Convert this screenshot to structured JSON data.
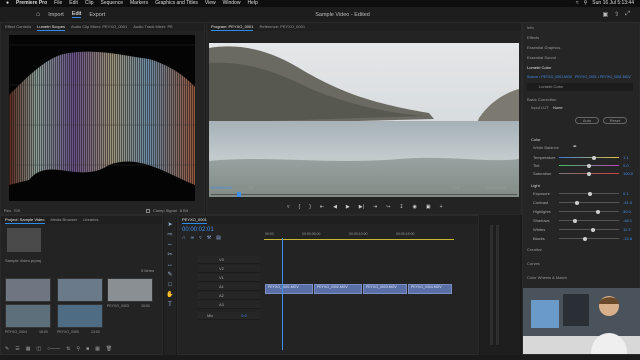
{
  "menubar": {
    "apple": "",
    "app": "Premiere Pro",
    "items": [
      "File",
      "Edit",
      "Clip",
      "Sequence",
      "Markers",
      "Graphics and Titles",
      "View",
      "Window",
      "Help"
    ],
    "clock": "Sun 16 Jul 5:13:44"
  },
  "header": {
    "home_icon": "home-icon",
    "tabs": [
      "Import",
      "Edit",
      "Export"
    ],
    "active_tab": "Edit",
    "title": "Sample Video - Edited"
  },
  "scopes_panel": {
    "tabs": [
      "Effect Controls",
      "Lumetri Scopes",
      "Audio Clip Mixer: PEYXO_0001",
      "Audio Track Mixer: PE"
    ],
    "active": "Lumetri Scopes",
    "footer_left": "Rec. 709",
    "clamp_label": "Clamp Signal",
    "bit_label": "8 Bit"
  },
  "program_panel": {
    "tabs": [
      "Program: PEYXO_0001",
      "Reference: PEYXO_0001"
    ],
    "timecode_left": "00:00:02:01",
    "fit": "Fit",
    "quality": "Full",
    "timecode_right": "00:00:20:00"
  },
  "project_panel": {
    "tabs": [
      "Project: Sample Video",
      "Media Browser",
      "Libraries"
    ],
    "file": "Sample Video.prproj",
    "count": "5 Items",
    "clips": [
      {
        "name": "PEYXO_0001",
        "dur": "19:00",
        "color": "#6f7681"
      },
      {
        "name": "PEYXO_0002",
        "dur": "11:00",
        "color": "#6a7a8a"
      },
      {
        "name": "PEYXO_0003",
        "dur": "15:00",
        "color": "#8a8f93"
      },
      {
        "name": "PEYXO_0004",
        "dur": "18:00",
        "color": "#5e6f7c"
      },
      {
        "name": "PEYXO_0005",
        "dur": "13:00",
        "color": "#4e6d84"
      }
    ]
  },
  "timeline": {
    "tab": "PEYXO_0001",
    "timecode": "00:00:02:01",
    "ruler": [
      "00:00",
      "00:00:05:00",
      "00:00:10:00",
      "00:00:15:00"
    ],
    "tracks": [
      "V3",
      "V2",
      "V1",
      "A1",
      "A2",
      "A3",
      "Mix"
    ],
    "mix_value": "0.0",
    "clips": [
      "PEYXO_0001.MOV",
      "PEYXO_0002.MOV",
      "PEYXO_0003.MOV",
      "PEYXO_0004.MOV"
    ]
  },
  "right_panel": {
    "list": [
      "Info",
      "Effects",
      "Essential Graphics",
      "Essential Sound"
    ],
    "lumetri_title": "Lumetri Color",
    "source_line": "Source • PEYXO_0001.MOV",
    "seq_line": "PEYXO_0001 • PEYXO_0001.MOV",
    "effect_name": "Lumetri Color",
    "basic_correction": "Basic Correction",
    "input_lut_label": "Input LUT",
    "input_lut_value": "None",
    "auto_label": "Auto",
    "reset_label": "Reset",
    "color_header": "Color",
    "white_balance": "White Balance",
    "color_sliders": [
      {
        "label": "Temperature",
        "value": "1.1",
        "pos": 0.58
      },
      {
        "label": "Tint",
        "value": "0.0",
        "pos": 0.5
      },
      {
        "label": "Saturation",
        "value": "100.0",
        "pos": 0.5
      }
    ],
    "light_header": "Light",
    "light_sliders": [
      {
        "label": "Exposure",
        "value": "0.1",
        "pos": 0.51
      },
      {
        "label": "Contrast",
        "value": "-41.0",
        "pos": 0.3
      },
      {
        "label": "Highlights",
        "value": "30.0",
        "pos": 0.65
      },
      {
        "label": "Shadows",
        "value": "-48.1",
        "pos": 0.26
      },
      {
        "label": "Whites",
        "value": "11.3",
        "pos": 0.56
      },
      {
        "label": "Blacks",
        "value": "-13.6",
        "pos": 0.43
      }
    ],
    "sections": [
      "Creative",
      "Curves",
      "Color Wheels & Match"
    ]
  }
}
